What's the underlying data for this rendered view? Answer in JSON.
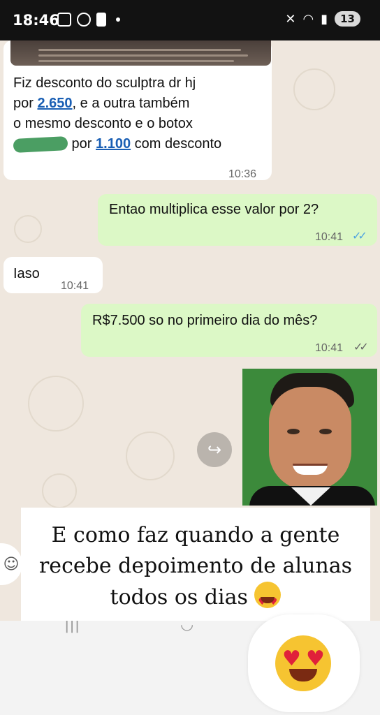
{
  "status_bar": {
    "time": "18:46",
    "notification_count": "13"
  },
  "messages": [
    {
      "direction": "incoming",
      "line1": "Fiz desconto do sculptra dr hj",
      "line2_pre": "por ",
      "line2_link": "2.650",
      "line2_post": ", e a outra também",
      "line3": "o mesmo desconto e o botox",
      "line4_pre": " por ",
      "line4_link": "1.100",
      "line4_post": " com desconto",
      "time": "10:36"
    },
    {
      "direction": "outgoing",
      "text": "Entao multiplica esse valor por 2?",
      "time": "10:41",
      "status": "read"
    },
    {
      "direction": "incoming",
      "text": "Iaso",
      "time": "10:41"
    },
    {
      "direction": "outgoing",
      "text": "R$7.500 so no primeiro dia do mês?",
      "time": "10:41",
      "status": "delivered"
    }
  ],
  "story_caption": {
    "line1": "E como faz quando a gente",
    "line2": "recebe depoimento de alunas",
    "line3": "todos os dias"
  },
  "colors": {
    "incoming_bubble": "#ffffff",
    "outgoing_bubble": "#dcf8c6",
    "read_ticks": "#4fa3e0",
    "delivered_ticks": "#666666",
    "link": "#1a5fb4"
  },
  "icons": {
    "forward": "forward-icon",
    "sticker": "sticker-icon",
    "reaction": "heart-eyes-emoji"
  }
}
